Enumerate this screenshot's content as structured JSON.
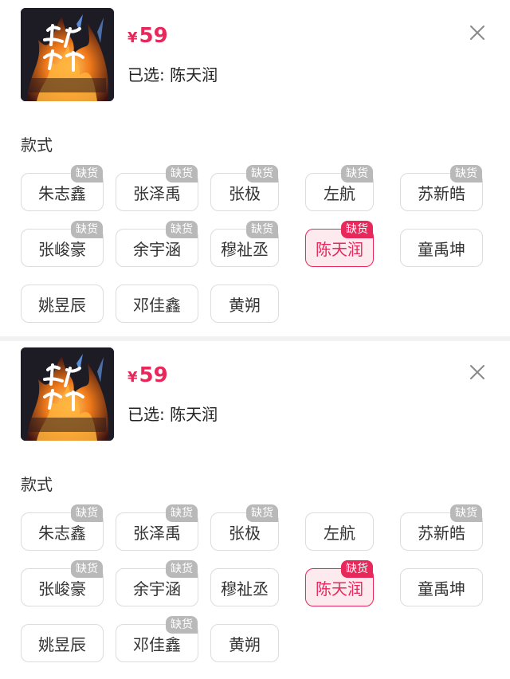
{
  "panels": [
    {
      "price_symbol": "¥",
      "price": "59",
      "selected_text": "已选: 陈天润",
      "section_label": "款式",
      "badge_text": "缺货",
      "options": [
        {
          "label": "朱志鑫",
          "out_of_stock": true,
          "selected": false
        },
        {
          "label": "张泽禹",
          "out_of_stock": true,
          "selected": false
        },
        {
          "label": "张极",
          "out_of_stock": true,
          "selected": false
        },
        {
          "label": "左航",
          "out_of_stock": true,
          "selected": false
        },
        {
          "label": "苏新皓",
          "out_of_stock": true,
          "selected": false
        },
        {
          "label": "张峻豪",
          "out_of_stock": true,
          "selected": false
        },
        {
          "label": "余宇涵",
          "out_of_stock": true,
          "selected": false
        },
        {
          "label": "穆祉丞",
          "out_of_stock": true,
          "selected": false
        },
        {
          "label": "陈天润",
          "out_of_stock": true,
          "selected": true
        },
        {
          "label": "童禹坤",
          "out_of_stock": false,
          "selected": false
        },
        {
          "label": "姚昱辰",
          "out_of_stock": false,
          "selected": false
        },
        {
          "label": "邓佳鑫",
          "out_of_stock": false,
          "selected": false
        },
        {
          "label": "黄朔",
          "out_of_stock": false,
          "selected": false
        }
      ]
    },
    {
      "price_symbol": "¥",
      "price": "59",
      "selected_text": "已选: 陈天润",
      "section_label": "款式",
      "badge_text": "缺货",
      "options": [
        {
          "label": "朱志鑫",
          "out_of_stock": true,
          "selected": false
        },
        {
          "label": "张泽禹",
          "out_of_stock": true,
          "selected": false
        },
        {
          "label": "张极",
          "out_of_stock": true,
          "selected": false
        },
        {
          "label": "左航",
          "out_of_stock": false,
          "selected": false
        },
        {
          "label": "苏新皓",
          "out_of_stock": true,
          "selected": false
        },
        {
          "label": "张峻豪",
          "out_of_stock": true,
          "selected": false
        },
        {
          "label": "余宇涵",
          "out_of_stock": true,
          "selected": false
        },
        {
          "label": "穆祉丞",
          "out_of_stock": false,
          "selected": false
        },
        {
          "label": "陈天润",
          "out_of_stock": true,
          "selected": true
        },
        {
          "label": "童禹坤",
          "out_of_stock": false,
          "selected": false
        },
        {
          "label": "姚昱辰",
          "out_of_stock": false,
          "selected": false
        },
        {
          "label": "邓佳鑫",
          "out_of_stock": true,
          "selected": false
        },
        {
          "label": "黄朔",
          "out_of_stock": false,
          "selected": false
        }
      ]
    }
  ],
  "colors": {
    "accent": "#e8275a",
    "selected_bg": "#fdeaee",
    "badge_gray": "#b9b9b9",
    "border": "#dcdcdc"
  },
  "icons": {
    "close": "close-icon",
    "thumbnail": "product-thumbnail"
  }
}
